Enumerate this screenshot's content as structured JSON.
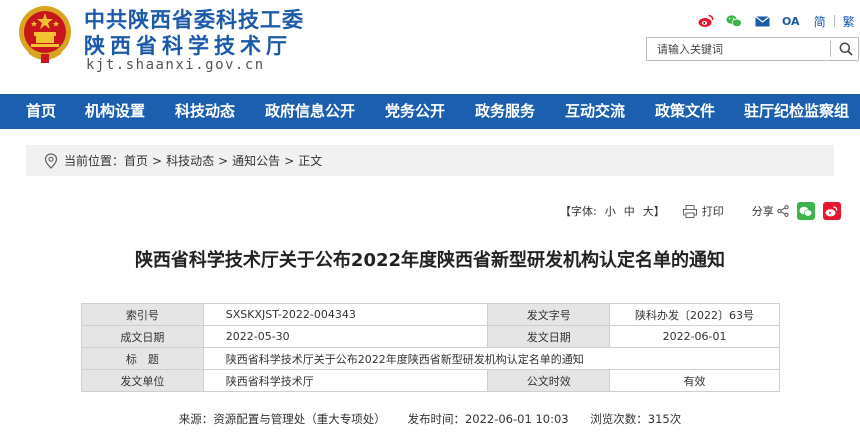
{
  "header": {
    "org_name": "中共陕西省委科技工委",
    "dept_name": "陕西省科学技术厅",
    "domain": "kjt.shaanxi.gov.cn",
    "top_links": {
      "oa": "OA",
      "lang_simplified": "简",
      "lang_traditional": "繁"
    },
    "search": {
      "placeholder": "请输入关键词"
    }
  },
  "nav": {
    "items": [
      "首页",
      "机构设置",
      "科技动态",
      "政府信息公开",
      "党务公开",
      "政务服务",
      "互动交流",
      "政策文件",
      "驻厅纪检监察组"
    ]
  },
  "breadcrumb": {
    "label": "当前位置：",
    "items": [
      "首页",
      "科技动态",
      "通知公告",
      "正文"
    ]
  },
  "toolbar": {
    "font_label": "【字体:",
    "small": "小",
    "medium": "中",
    "large": "大",
    "close_bracket": "】",
    "print": "打印",
    "share": "分享"
  },
  "article": {
    "title": "陕西省科学技术厅关于公布2022年度陕西省新型研发机构认定名单的通知",
    "meta": {
      "index_label": "索引号",
      "index_value": "SXSKXJST-2022-004343",
      "doc_no_label": "发文字号",
      "doc_no_value": "陕科办发〔2022〕63号",
      "created_label": "成文日期",
      "created_value": "2022-05-30",
      "issued_label": "发文日期",
      "issued_value": "2022-06-01",
      "title_label": "标　题",
      "title_value": "陕西省科学技术厅关于公布2022年度陕西省新型研发机构认定名单的通知",
      "issuer_label": "发文单位",
      "issuer_value": "陕西省科学技术厅",
      "validity_label": "公文时效",
      "validity_value": "有效"
    },
    "source": "来源：资源配置与管理处（重大专项处）",
    "publish_time": "发布时间：2022-06-01 10:03",
    "views": "浏览次数：315次"
  },
  "colors": {
    "brand_blue": "#1c5fae",
    "title_blue": "#1a5aa8",
    "wechat_green": "#3bb54a",
    "weibo_red": "#e6162d"
  }
}
